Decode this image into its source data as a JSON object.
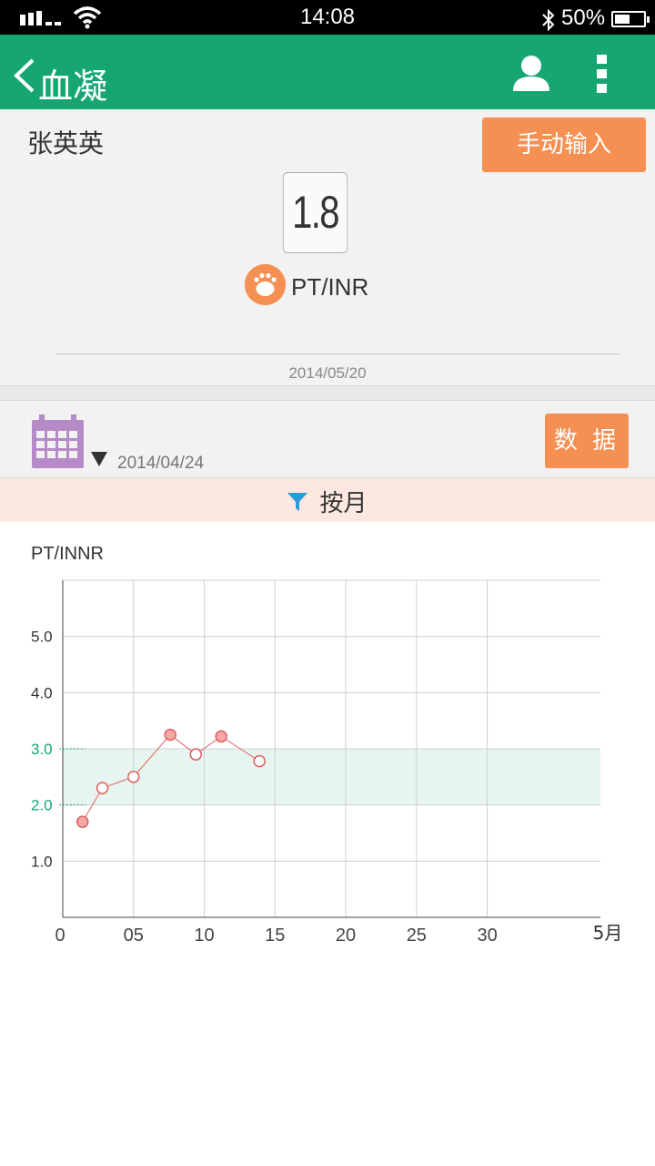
{
  "status_bar": {
    "time": "14:08",
    "battery": "50%"
  },
  "header": {
    "title": "血凝"
  },
  "patient": {
    "name": "张英英"
  },
  "summary": {
    "manual_input_label": "手动输入",
    "latest_value": "1.8",
    "metric": "PT/INR",
    "date": "2014/05/20"
  },
  "filter": {
    "start_date": "2014/04/24",
    "data_label": "数 据",
    "period_label": "按月"
  },
  "colors": {
    "primary": "#16a672",
    "accent": "#f58f52",
    "band": "#e6f5f0",
    "line": "#e06060"
  },
  "chart_data": {
    "type": "line",
    "ylabel": "PT/INNR",
    "xlabel": "5月",
    "xlim": [
      0,
      38
    ],
    "ylim": [
      0,
      6
    ],
    "x_ticks": [
      "0",
      "05",
      "10",
      "15",
      "20",
      "25",
      "30"
    ],
    "y_ticks": [
      "1.0",
      "2.0",
      "3.0",
      "4.0",
      "5.0"
    ],
    "target_range": [
      2.0,
      3.0
    ],
    "series": [
      {
        "points": [
          {
            "x": 1.4,
            "y": 1.7,
            "filled": true
          },
          {
            "x": 2.8,
            "y": 2.3,
            "filled": false
          },
          {
            "x": 5.0,
            "y": 2.5,
            "filled": false
          },
          {
            "x": 7.6,
            "y": 3.25,
            "filled": true
          },
          {
            "x": 9.4,
            "y": 2.9,
            "filled": false
          },
          {
            "x": 11.2,
            "y": 3.22,
            "filled": true
          },
          {
            "x": 13.9,
            "y": 2.78,
            "filled": false
          }
        ]
      }
    ]
  }
}
